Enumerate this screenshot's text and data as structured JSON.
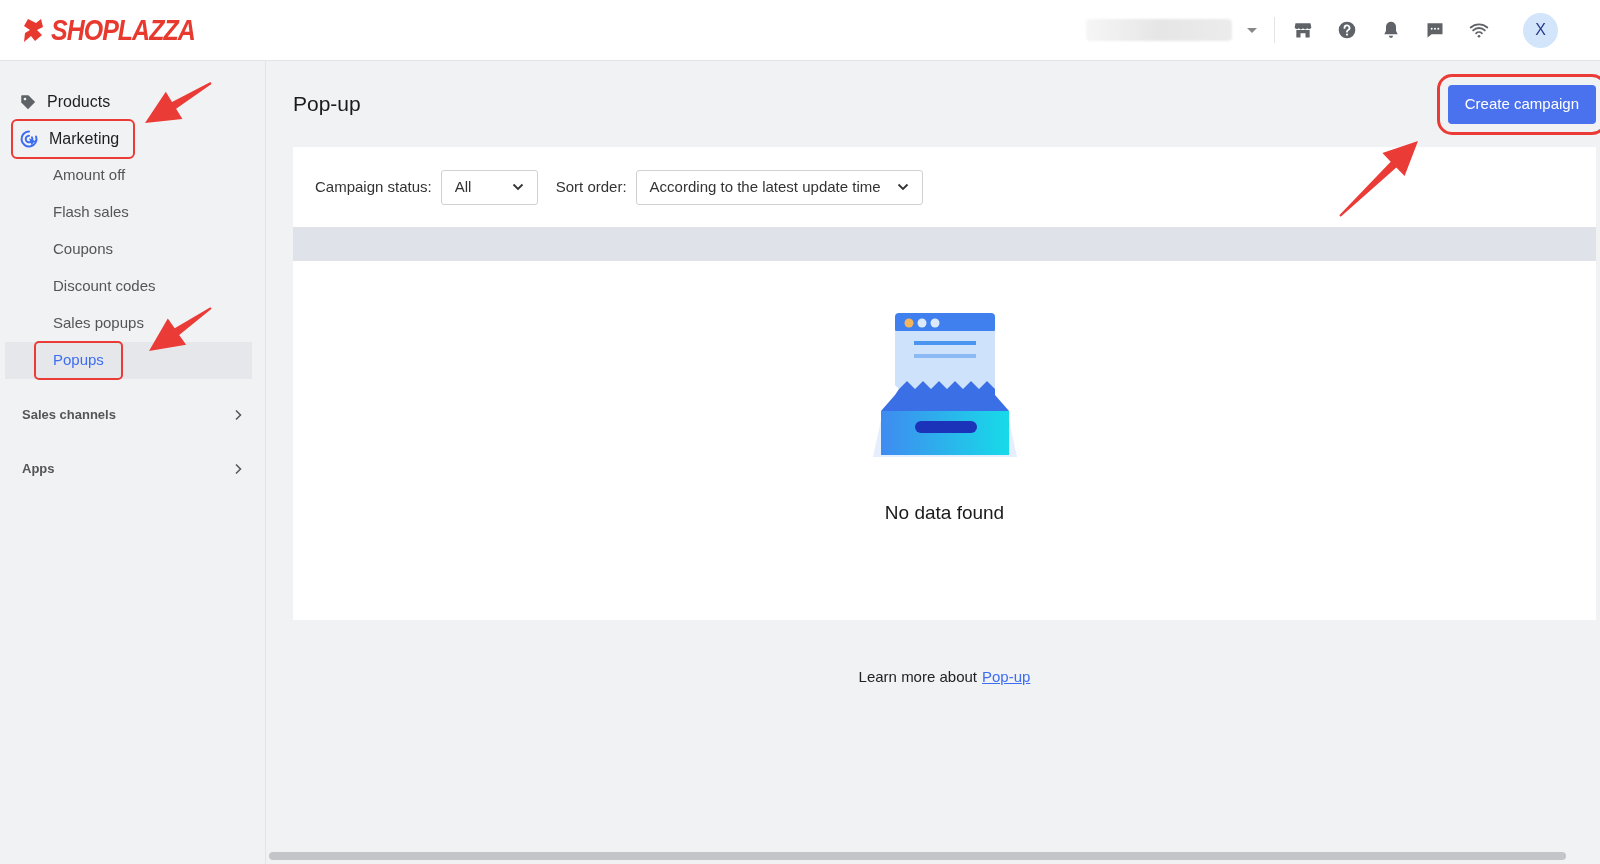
{
  "header": {
    "brand": "SHOPLAZZA",
    "avatar": "X"
  },
  "sidebar": {
    "items": [
      {
        "label": "Products",
        "kind": "tag",
        "highlighted": false
      },
      {
        "label": "Marketing",
        "kind": "marketing",
        "highlighted": true,
        "children": [
          {
            "label": "Amount off",
            "selected": false,
            "highlighted": false
          },
          {
            "label": "Flash sales",
            "selected": false,
            "highlighted": false
          },
          {
            "label": "Coupons",
            "selected": false,
            "highlighted": false
          },
          {
            "label": "Discount codes",
            "selected": false,
            "highlighted": false
          },
          {
            "label": "Sales popups",
            "selected": false,
            "highlighted": false
          },
          {
            "label": "Popups",
            "selected": true,
            "highlighted": true
          }
        ]
      }
    ],
    "sections": [
      "Sales channels",
      "Apps"
    ]
  },
  "page": {
    "title": "Pop-up",
    "primary_button": {
      "label": "Create campaign",
      "highlighted": true
    }
  },
  "filters": [
    {
      "label": "Campaign status:",
      "value": "All"
    },
    {
      "label": "Sort order:",
      "value": "According to the latest update time"
    }
  ],
  "empty_state": {
    "message": "No data found"
  },
  "footer": {
    "text": "Learn more about",
    "link": "Pop-up"
  }
}
